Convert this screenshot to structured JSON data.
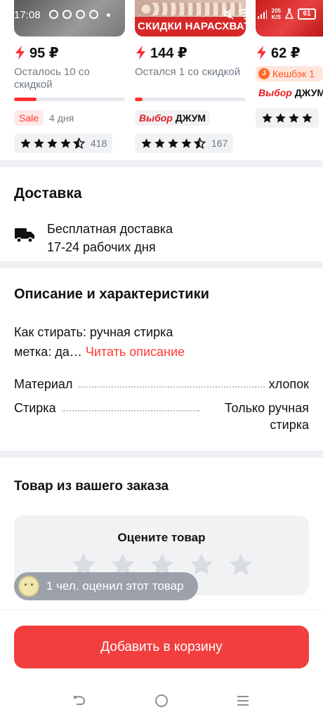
{
  "status_bar": {
    "time": "17:08",
    "net_speed": "205",
    "net_unit": "K/S",
    "battery": "61"
  },
  "products": [
    {
      "price": "95 ₽",
      "stock_note": "Осталось 10 со скидкой",
      "progress": 0.2,
      "tag": "Sale",
      "tag_extra": "4 дня",
      "rating_count": "418"
    },
    {
      "price": "144 ₽",
      "stock_note": "Остался 1 со скидкой",
      "progress": 0.07,
      "choice_brand": "Выбор",
      "choice_name": "ДЖУМ",
      "rating_count": "167",
      "banner": "СКИДКИ НАРАСХВАТ"
    },
    {
      "price": "62 ₽",
      "cashback": "Кешбэк 1",
      "choice_brand": "Выбор",
      "choice_name": "ДЖУМ"
    }
  ],
  "delivery": {
    "title": "Доставка",
    "line1": "Бесплатная доставка",
    "line2": "17-24 рабочих дня"
  },
  "description": {
    "title": "Описание и характеристики",
    "line1": "Как стирать: ручная стирка",
    "line2": "метка: да…",
    "read_more": "Читать описание",
    "specs": [
      {
        "label": "Материал",
        "value": "хлопок"
      },
      {
        "label": "Стирка",
        "value": "Только ручная стирка"
      }
    ]
  },
  "order": {
    "title": "Товар из вашего заказа",
    "rate_prompt": "Оцените товар",
    "rated_count": "1 чел. оценил этот товар"
  },
  "cart_button": "Добавить в корзину",
  "colors": {
    "accent": "#f23e3e",
    "muted": "#707a86",
    "bg_sep": "#eef0f3"
  }
}
